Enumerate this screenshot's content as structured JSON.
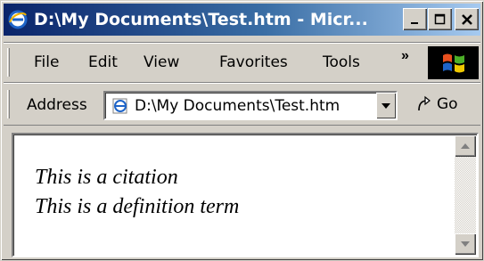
{
  "window": {
    "title": "D:\\My Documents\\Test.htm - Micr...",
    "icon": "internet-explorer-icon",
    "caption_buttons": {
      "minimize": "minimize-icon",
      "maximize": "maximize-icon",
      "close": "close-icon"
    }
  },
  "menu": {
    "items": [
      {
        "label": "File"
      },
      {
        "label": "Edit"
      },
      {
        "label": "View"
      },
      {
        "label": "Favorites"
      },
      {
        "label": "Tools"
      }
    ],
    "overflow_label": "»",
    "logo": "windows-logo-icon"
  },
  "address_bar": {
    "label": "Address",
    "value": "D:\\My Documents\\Test.htm",
    "page_icon": "ie-page-icon",
    "go_label": "Go"
  },
  "content": {
    "lines": [
      {
        "text": "This is a citation"
      },
      {
        "text": "This is a definition term"
      }
    ]
  },
  "colors": {
    "titlebar_start": "#0a246a",
    "titlebar_end": "#a6caf0",
    "chrome": "#d4d0c8"
  }
}
